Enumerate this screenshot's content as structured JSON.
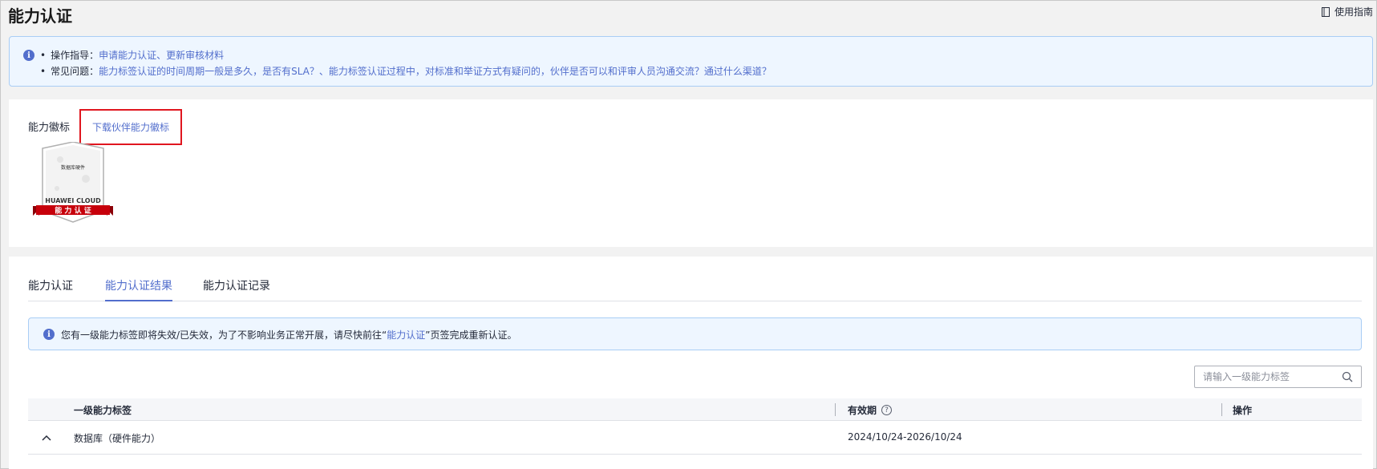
{
  "page": {
    "title": "能力认证",
    "guide_label": "使用指南"
  },
  "notice": {
    "line1_prefix": "操作指导：",
    "line1_links": "申请能力认证、更新审核材料",
    "line2_prefix": "常见问题：",
    "line2_links": "能力标签认证的时间周期一般是多久，是否有SLA？、能力标签认证过程中，对标准和举证方式有疑问的，伙伴是否可以和评审人员沟通交流？通过什么渠道？"
  },
  "badge_section": {
    "label": "能力徽标",
    "download_link": "下载伙伴能力徽标",
    "badge": {
      "category": "数据库硬件",
      "brand": "HUAWEI CLOUD",
      "ribbon": "能 力 认 证",
      "ribbon_color": "#c7000b"
    }
  },
  "tabs": [
    {
      "label": "能力认证",
      "active": false
    },
    {
      "label": "能力认证结果",
      "active": true
    },
    {
      "label": "能力认证记录",
      "active": false
    }
  ],
  "warning": {
    "text_before": "您有一级能力标签即将失效/已失效，为了不影响业务正常开展，请尽快前往“",
    "link": "能力认证",
    "text_after": "”页签完成重新认证。"
  },
  "search": {
    "placeholder": "请输入一级能力标签",
    "value": ""
  },
  "table": {
    "columns": [
      "一级能力标签",
      "有效期",
      "操作"
    ],
    "rows": [
      {
        "label": "数据库（硬件能力）",
        "validity": "2024/10/24-2026/10/24",
        "action": ""
      }
    ]
  },
  "colors": {
    "accent": "#526ecc",
    "highlight_border": "#e0161f",
    "info_bg": "#eef6ff"
  }
}
